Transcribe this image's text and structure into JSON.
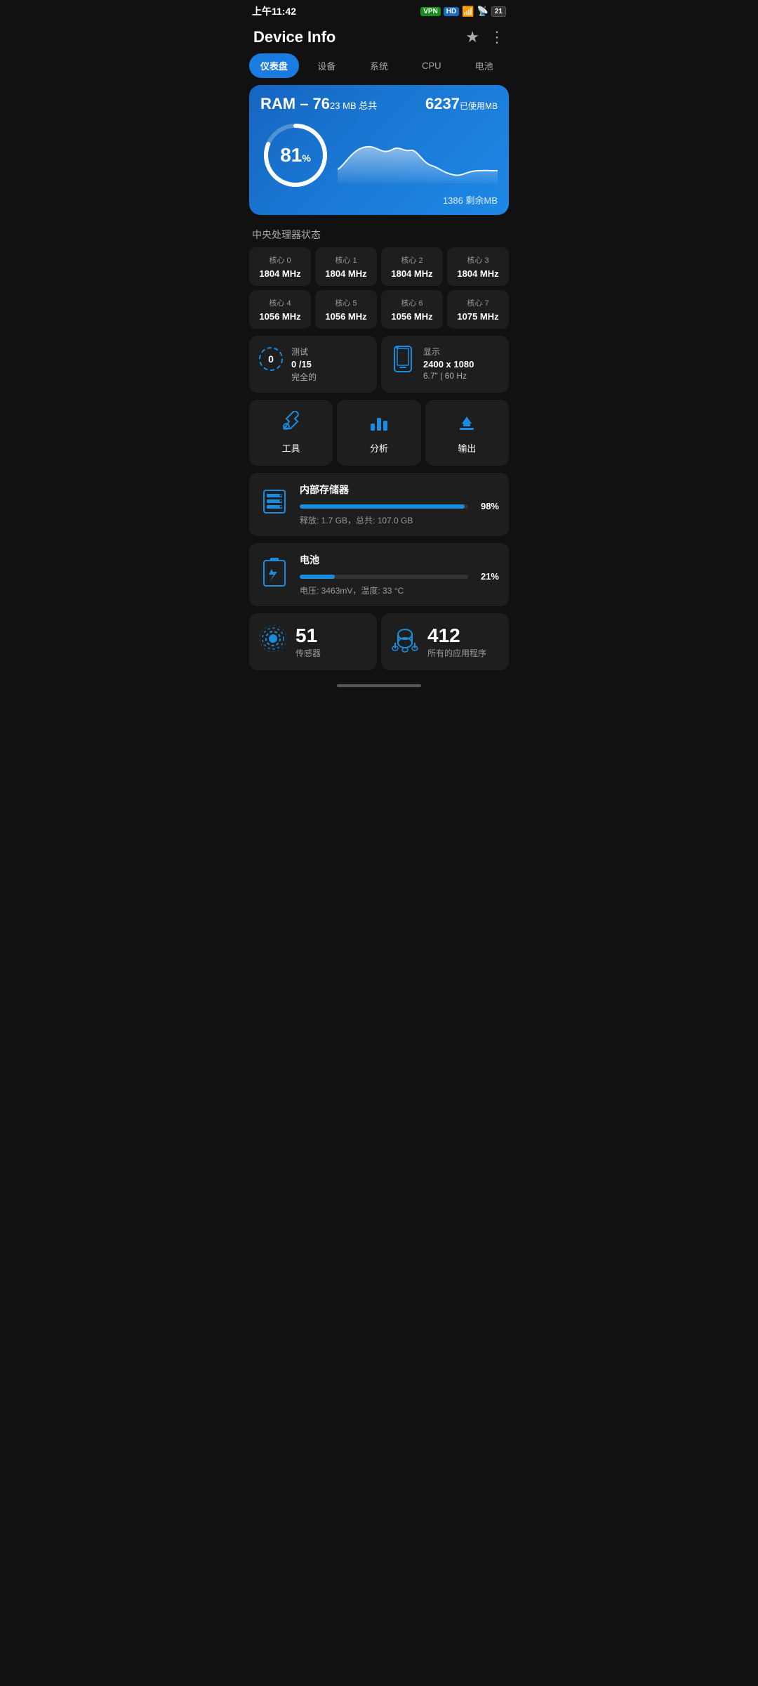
{
  "statusBar": {
    "time": "上午11:42",
    "vpn": "VPN",
    "hd": "HD",
    "battery": "21"
  },
  "header": {
    "title": "Device Info",
    "starLabel": "★",
    "menuLabel": "⋮"
  },
  "tabs": [
    {
      "id": "dashboard",
      "label": "仪表盘",
      "active": true
    },
    {
      "id": "devices",
      "label": "设备",
      "active": false
    },
    {
      "id": "system",
      "label": "系统",
      "active": false
    },
    {
      "id": "cpu",
      "label": "CPU",
      "active": false
    },
    {
      "id": "battery-tab",
      "label": "电池",
      "active": false
    }
  ],
  "ram": {
    "title": "RAM – 76",
    "titleSub": "23 MB 总共",
    "usedLabel": "已使用MB",
    "usedValue": "6237",
    "percentage": 81,
    "remainLabel": "剩余MB",
    "remainValue": "1386"
  },
  "cpuSection": {
    "title": "中央处理器状态",
    "cores": [
      {
        "name": "核心 0",
        "freq": "1804 MHz"
      },
      {
        "name": "核心 1",
        "freq": "1804 MHz"
      },
      {
        "name": "核心 2",
        "freq": "1804 MHz"
      },
      {
        "name": "核心 3",
        "freq": "1804 MHz"
      },
      {
        "name": "核心 4",
        "freq": "1056 MHz"
      },
      {
        "name": "核心 5",
        "freq": "1056 MHz"
      },
      {
        "name": "核心 6",
        "freq": "1056 MHz"
      },
      {
        "name": "核心 7",
        "freq": "1075 MHz"
      }
    ]
  },
  "middleCards": [
    {
      "id": "test-card",
      "label": "测试",
      "value": "0 /15",
      "sub": "完全的",
      "iconSymbol": "0"
    },
    {
      "id": "display-card",
      "label": "显示",
      "value": "2400 x 1080",
      "sub": "6.7\" | 60 Hz"
    }
  ],
  "actions": [
    {
      "id": "tools",
      "label": "工具",
      "icon": "🔧"
    },
    {
      "id": "analysis",
      "label": "分析",
      "icon": "📊"
    },
    {
      "id": "output",
      "label": "输出",
      "icon": "⬇"
    }
  ],
  "storage": {
    "title": "内部存储器",
    "percent": 98,
    "percentLabel": "98%",
    "sub": "释放: 1.7 GB，总共: 107.0 GB"
  },
  "battery": {
    "title": "电池",
    "percent": 21,
    "percentLabel": "21%",
    "sub": "电压: 3463mV，温度: 33 °C"
  },
  "sensors": {
    "count": "51",
    "label": "传感器"
  },
  "apps": {
    "count": "412",
    "label": "所有的应用程序"
  }
}
